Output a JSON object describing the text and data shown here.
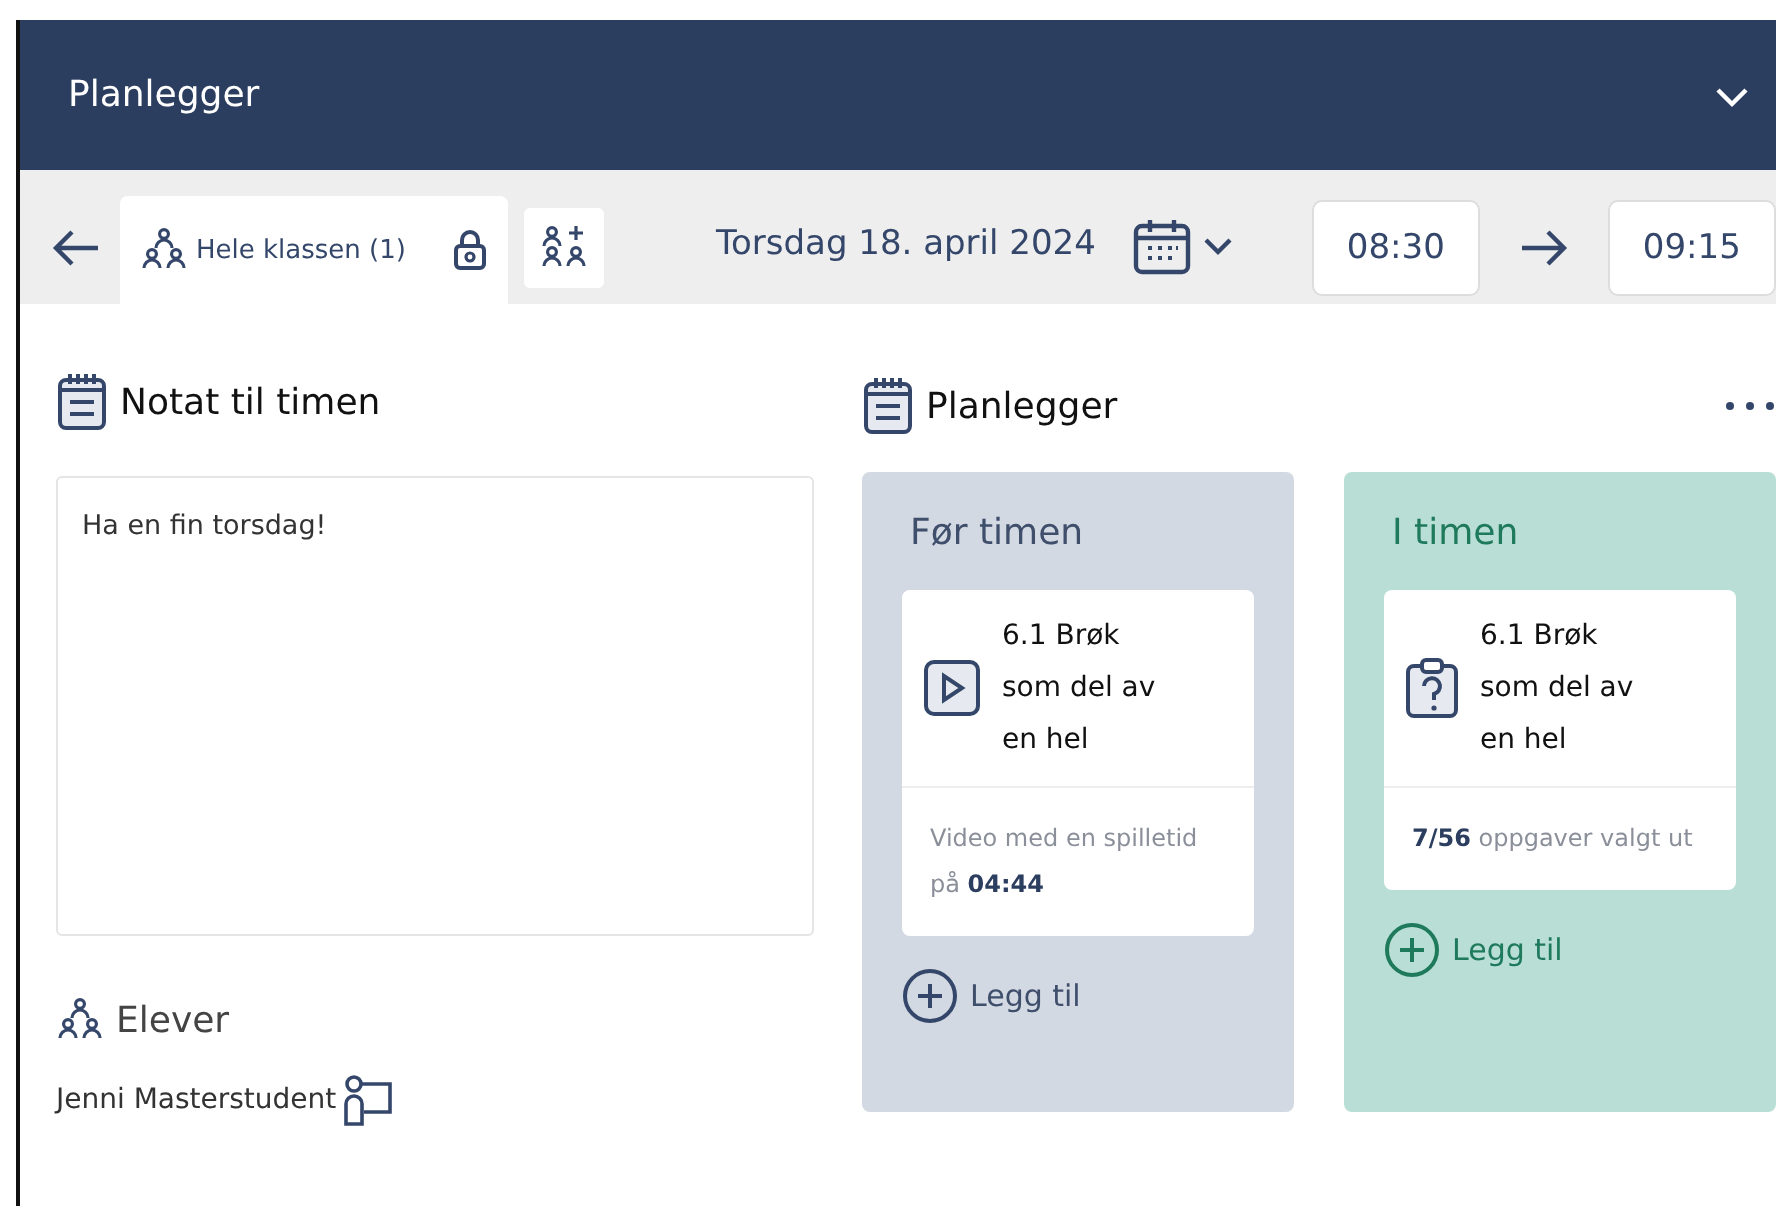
{
  "header": {
    "title": "Planlegger"
  },
  "toolbar": {
    "group_tab": {
      "label": "Hele klassen (1)",
      "selected": true,
      "locked": true
    },
    "date": "Torsdag 18. april 2024",
    "start": "08:30",
    "end": "09:15"
  },
  "note": {
    "title": "Notat til timen",
    "text": "Ha en fin torsdag!"
  },
  "students": {
    "title": "Elever",
    "items": [
      {
        "name": "Jenni Masterstudent"
      }
    ]
  },
  "planner": {
    "title": "Planlegger",
    "columns": [
      {
        "title": "Før timen",
        "color": "#d3d9e3",
        "items": [
          {
            "kind": "video",
            "title": "6.1 Brøk som del av en hel",
            "description": "Video med en spilletid på **04:44**"
          }
        ],
        "add_label": "Legg til"
      },
      {
        "title": "I timen",
        "color": "#b8ded6",
        "items": [
          {
            "kind": "quiz",
            "title": "6.1 Brøk som del av en hel",
            "description": "**7/56** oppgaver valgt ut"
          }
        ],
        "add_label": "Legg til"
      }
    ]
  }
}
